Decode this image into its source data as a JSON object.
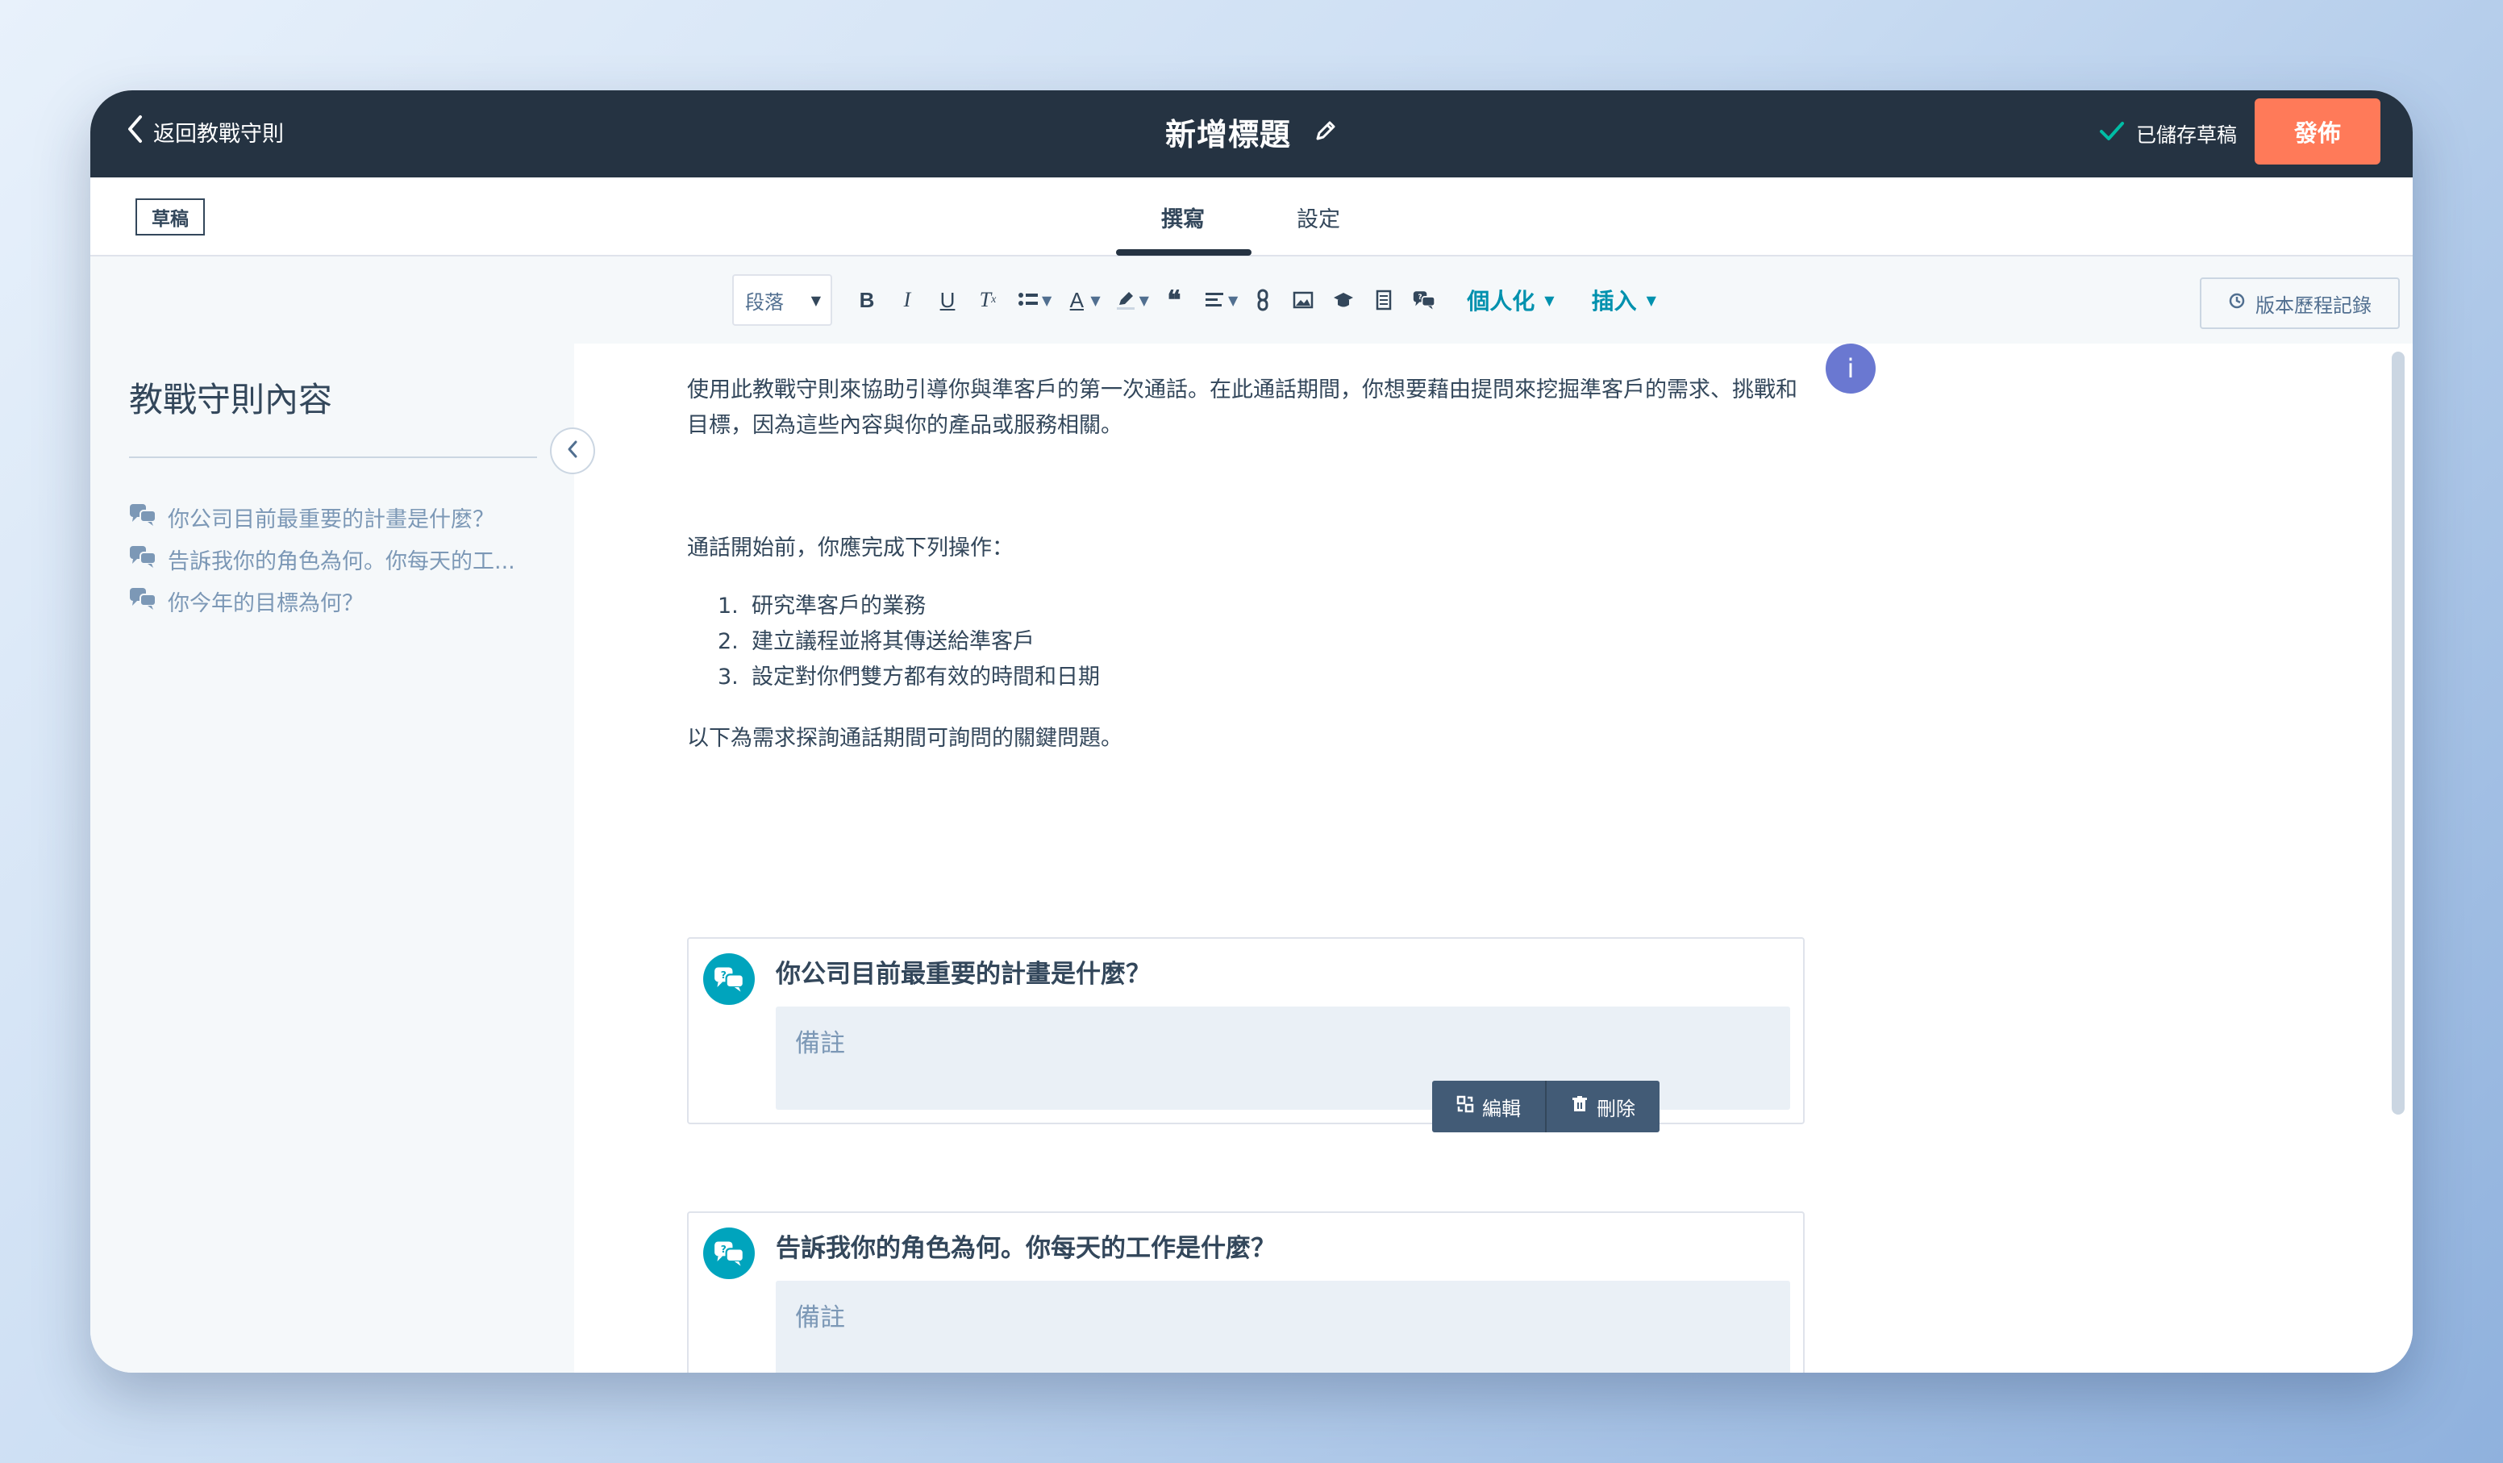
{
  "header": {
    "back_label": "返回教戰守則",
    "title": "新增標題",
    "saved_label": "已儲存草稿",
    "publish_label": "發佈"
  },
  "tabs": {
    "status_badge": "草稿",
    "items": [
      {
        "label": "撰寫",
        "active": true
      },
      {
        "label": "設定",
        "active": false
      }
    ]
  },
  "toolbar": {
    "paragraph_select": "段落",
    "personalize_label": "個人化",
    "insert_label": "插入",
    "history_label": "版本歷程記錄"
  },
  "sidebar": {
    "title": "教戰守則內容",
    "items": [
      {
        "label": "你公司目前最重要的計畫是什麼？"
      },
      {
        "label": "告訴我你的角色為何。你每天的工..."
      },
      {
        "label": "你今年的目標為何？"
      }
    ]
  },
  "editor": {
    "intro": "使用此教戰守則來協助引導你與準客戶的第一次通話。在此通話期間，你想要藉由提問來挖掘準客戶的需求、挑戰和目標，因為這些內容與你的產品或服務相關。",
    "before_call": "通話開始前，你應完成下列操作：",
    "steps": [
      {
        "num": "1.",
        "text": "研究準客戶的業務"
      },
      {
        "num": "2.",
        "text": "建立議程並將其傳送給準客戶"
      },
      {
        "num": "3.",
        "text": "設定對你們雙方都有效的時間和日期"
      }
    ],
    "key_questions": "以下為需求探詢通話期間可詢問的關鍵問題。",
    "info_marker": "i",
    "questions": [
      {
        "text": "你公司目前最重要的計畫是什麼？",
        "notes_placeholder": "備註"
      },
      {
        "text": "告訴我你的角色為何。你每天的工作是什麼？",
        "notes_placeholder": "備註"
      }
    ],
    "actions": {
      "edit_label": "編輯",
      "delete_label": "刪除"
    }
  },
  "colors": {
    "header_bg": "#253342",
    "publish": "#ff7a59",
    "accent_teal": "#00a4bd",
    "link_blue": "#0091ae",
    "info": "#6a78d1"
  }
}
